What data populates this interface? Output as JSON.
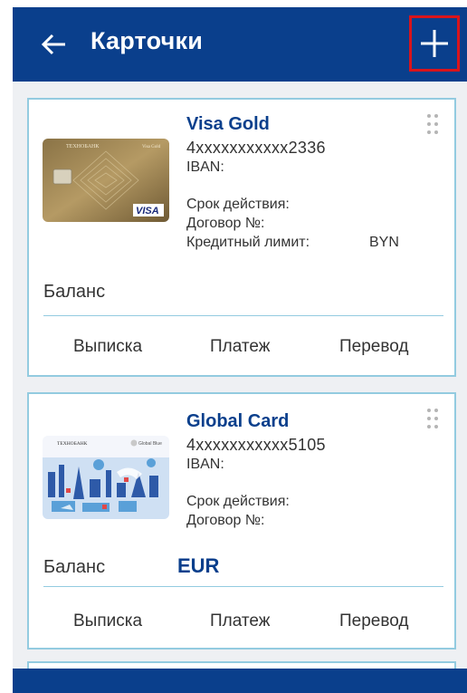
{
  "appbar": {
    "title": "Карточки",
    "back_icon": "arrow-left-icon",
    "add_icon": "plus-icon",
    "color": "#0a3f8c",
    "highlight_color": "#d9141b"
  },
  "cards": [
    {
      "name": "Visa Gold",
      "number": "4xxxxxxxxxxx2336",
      "iban_label": "IBAN:",
      "expiry_label": "Срок действия:",
      "contract_label": "Договор №:",
      "credit_limit_label": "Кредитный лимит:",
      "credit_limit_currency": "BYN",
      "balance_label": "Баланс",
      "balance_currency": "",
      "image": {
        "bank": "ТЕХНОБАНК",
        "product": "Visa Gold",
        "brand": "VISA"
      },
      "actions": [
        "Выписка",
        "Платеж",
        "Перевод"
      ]
    },
    {
      "name": "Global Card",
      "number": "4xxxxxxxxxxx5105",
      "iban_label": "IBAN:",
      "expiry_label": "Срок действия:",
      "contract_label": "Договор №:",
      "balance_label": "Баланс",
      "balance_currency": "EUR",
      "image": {
        "bank": "ТЕХНОБАНК",
        "product": "Global Blue"
      },
      "actions": [
        "Выписка",
        "Платеж",
        "Перевод"
      ]
    }
  ]
}
